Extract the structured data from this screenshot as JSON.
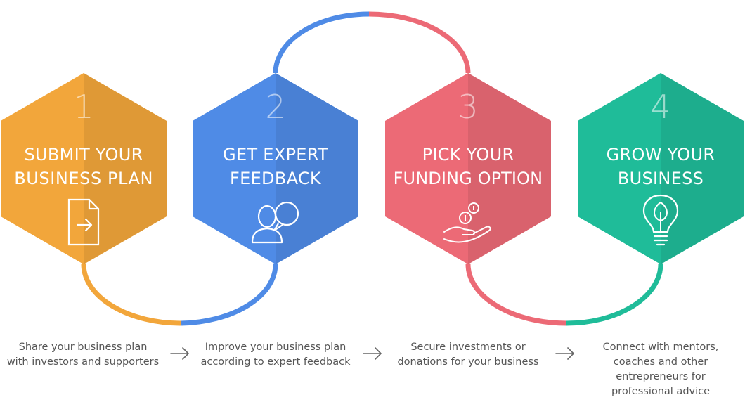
{
  "colors": {
    "orange": "#f2a63b",
    "blue": "#4f8be6",
    "red": "#ec6a76",
    "green": "#1fbc99",
    "text": "#555555"
  },
  "steps": [
    {
      "number": "1",
      "title_lines": [
        "SUBMIT YOUR",
        "BUSINESS PLAN"
      ],
      "icon": "document-arrow-icon",
      "color": "orange",
      "description_lines": [
        "Share your business plan",
        "with investors and supporters"
      ]
    },
    {
      "number": "2",
      "title_lines": [
        "GET EXPERT",
        "FEEDBACK"
      ],
      "icon": "person-speech-bubble-icon",
      "color": "blue",
      "description_lines": [
        "Improve your business plan",
        "according to expert feedback"
      ]
    },
    {
      "number": "3",
      "title_lines": [
        "PICK YOUR",
        "FUNDING OPTION"
      ],
      "icon": "hand-coins-icon",
      "color": "red",
      "description_lines": [
        "Secure investments or",
        "donations for your business"
      ]
    },
    {
      "number": "4",
      "title_lines": [
        "GROW YOUR",
        "BUSINESS"
      ],
      "icon": "lightbulb-leaf-icon",
      "color": "green",
      "description_lines": [
        "Connect with mentors,",
        "coaches and other",
        "entrepreneurs for",
        "professional advice"
      ]
    }
  ],
  "connector": "arrow-right-icon"
}
